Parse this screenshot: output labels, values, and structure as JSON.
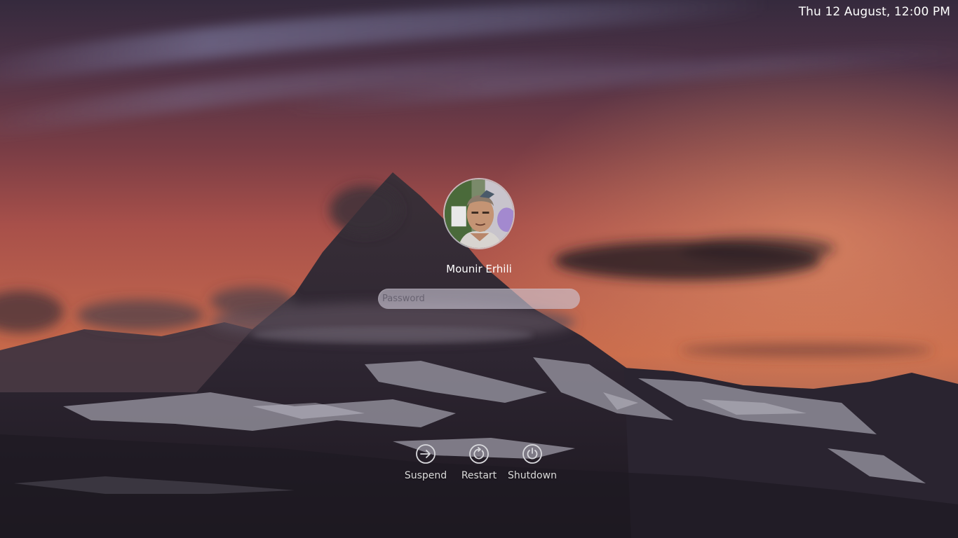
{
  "clock": {
    "text": "Thu 12 August, 12:00 PM"
  },
  "user": {
    "name": "Mounir Erhili"
  },
  "password": {
    "placeholder": "Password",
    "value": ""
  },
  "power_actions": [
    {
      "label": "Suspend",
      "icon": "suspend-arrow-icon"
    },
    {
      "label": "Restart",
      "icon": "restart-icon"
    },
    {
      "label": "Shutdown",
      "icon": "power-icon"
    }
  ],
  "wallpaper": {
    "subject": "mountain-at-sunset",
    "colors": {
      "sky_top": "#3a2c40",
      "sky_mid": "#b2524a",
      "horizon": "#e07a4a",
      "mountain": "#2b2430",
      "snow": "#9a98a4"
    }
  }
}
